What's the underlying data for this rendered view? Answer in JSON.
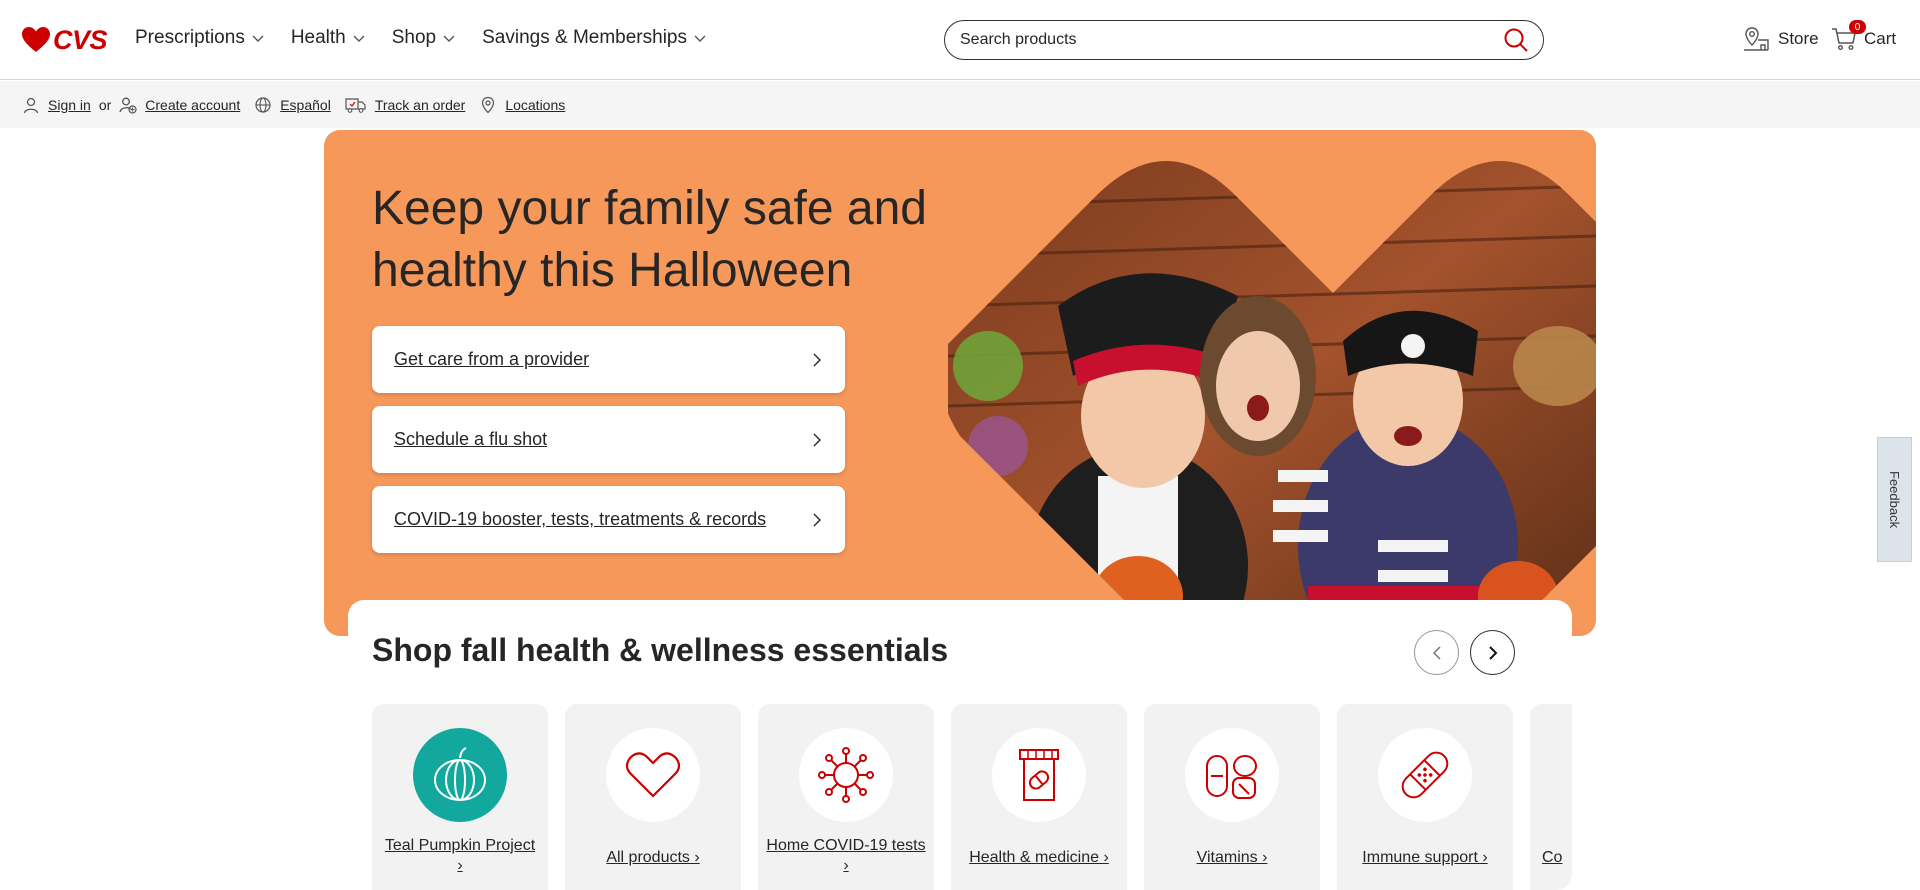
{
  "header": {
    "logo_text": "CVS",
    "nav": [
      {
        "label": "Prescriptions"
      },
      {
        "label": "Health"
      },
      {
        "label": "Shop"
      },
      {
        "label": "Savings & Memberships"
      }
    ],
    "search_placeholder": "Search products",
    "store_label": "Store",
    "cart_label": "Cart",
    "cart_count": "0"
  },
  "subbar": {
    "sign_in": "Sign in",
    "or": "or",
    "create_account": "Create account",
    "language": "Español",
    "track_order": "Track an order",
    "locations": "Locations"
  },
  "hero": {
    "title": "Keep your family safe and healthy this Halloween",
    "buttons": [
      {
        "label": "Get care from a provider"
      },
      {
        "label": "Schedule a flu shot"
      },
      {
        "label": "COVID-19 booster, tests, treatments & records"
      }
    ]
  },
  "shop": {
    "title": "Shop fall health & wellness essentials",
    "tiles": [
      {
        "label": "Teal Pumpkin Project ›",
        "icon": "pumpkin-icon"
      },
      {
        "label": "All products ›",
        "icon": "heart-icon"
      },
      {
        "label": "Home COVID-19 tests ›",
        "icon": "virus-icon"
      },
      {
        "label": "Health & medicine ›",
        "icon": "medicine-bottle-icon"
      },
      {
        "label": "Vitamins ›",
        "icon": "pills-icon"
      },
      {
        "label": "Immune support ›",
        "icon": "bandage-icon"
      },
      {
        "label": "Co",
        "icon": "partial-icon"
      }
    ]
  },
  "feedback_label": "Feedback",
  "colors": {
    "brand_red": "#cc0000",
    "hero_orange": "#f5985a",
    "teal": "#13a89e"
  }
}
